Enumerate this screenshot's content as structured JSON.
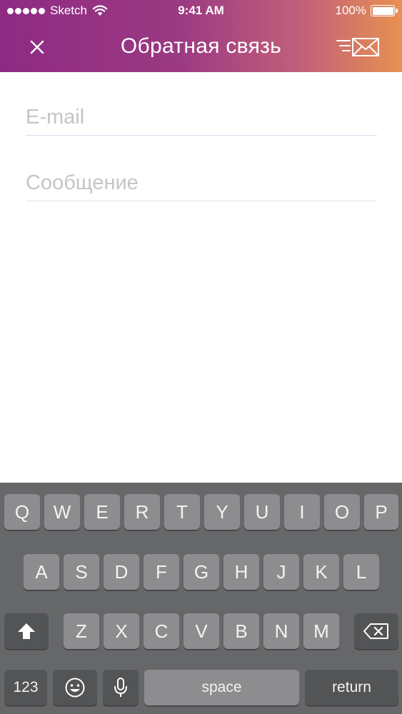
{
  "status_bar": {
    "carrier": "Sketch",
    "time": "9:41 AM",
    "battery": "100%"
  },
  "nav": {
    "title": "Обратная связь",
    "close_icon": "close-icon",
    "send_icon": "send-message-icon"
  },
  "form": {
    "email_placeholder": "E-mail",
    "email_value": "",
    "message_placeholder": "Сообщение",
    "message_value": ""
  },
  "keyboard": {
    "row1": [
      "Q",
      "W",
      "E",
      "R",
      "T",
      "Y",
      "U",
      "I",
      "O",
      "P"
    ],
    "row2": [
      "A",
      "S",
      "D",
      "F",
      "G",
      "H",
      "J",
      "K",
      "L"
    ],
    "row3": [
      "Z",
      "X",
      "C",
      "V",
      "B",
      "N",
      "M"
    ],
    "numbers_label": "123",
    "space_label": "space",
    "return_label": "return"
  },
  "colors": {
    "header_gradient_start": "#8e2a83",
    "header_gradient_end": "#e89150",
    "keyboard_bg": "#666768",
    "key_bg": "#8d8d8f",
    "key_dark_bg": "#535455"
  }
}
